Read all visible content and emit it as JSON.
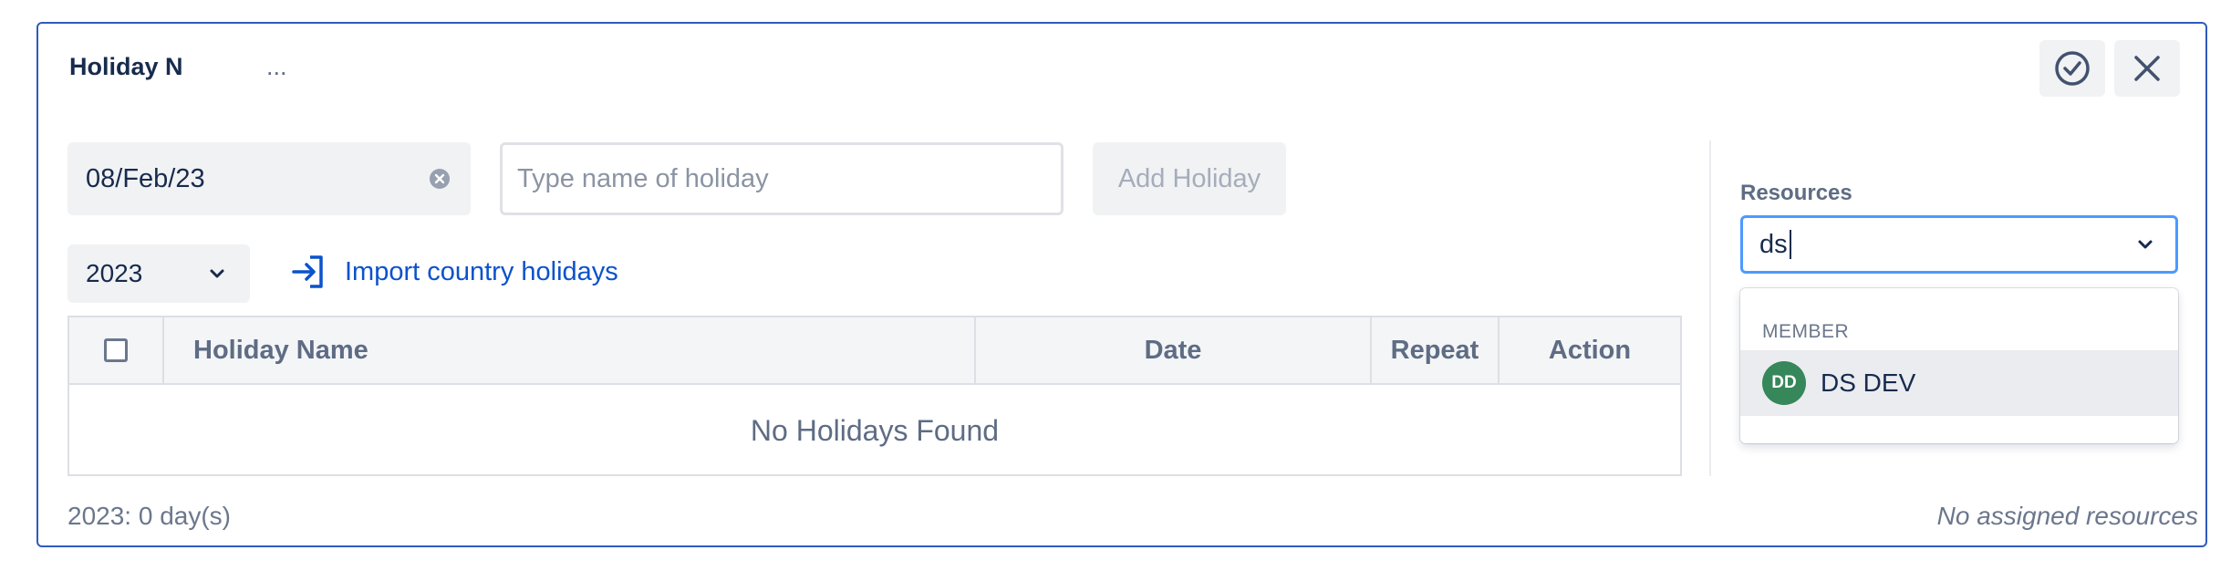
{
  "panel": {
    "title": "Holiday N",
    "title_more": "...",
    "actions": {
      "confirm_icon": "check-circle-icon",
      "close_icon": "close-icon"
    }
  },
  "form": {
    "date_value": "08/Feb/23",
    "name_placeholder": "Type name of holiday",
    "add_button": "Add Holiday"
  },
  "year_select": {
    "value": "2023"
  },
  "import_link": {
    "label": "Import country holidays",
    "icon": "import-icon"
  },
  "table": {
    "columns": [
      "Holiday Name",
      "Date",
      "Repeat",
      "Action"
    ],
    "empty_message": "No Holidays Found"
  },
  "footer": {
    "day_count": "2023: 0 day(s)",
    "assigned_resources": "No assigned resources"
  },
  "resources": {
    "label": "Resources",
    "input_value": "ds",
    "dropdown": {
      "group": "MEMBER",
      "options": [
        {
          "initials": "DD",
          "label": "DS DEV"
        }
      ]
    }
  },
  "colors": {
    "panel_border": "#2f5bbf",
    "link": "#0c52cc",
    "focus": "#4c9aff",
    "avatar": "#36875a"
  }
}
